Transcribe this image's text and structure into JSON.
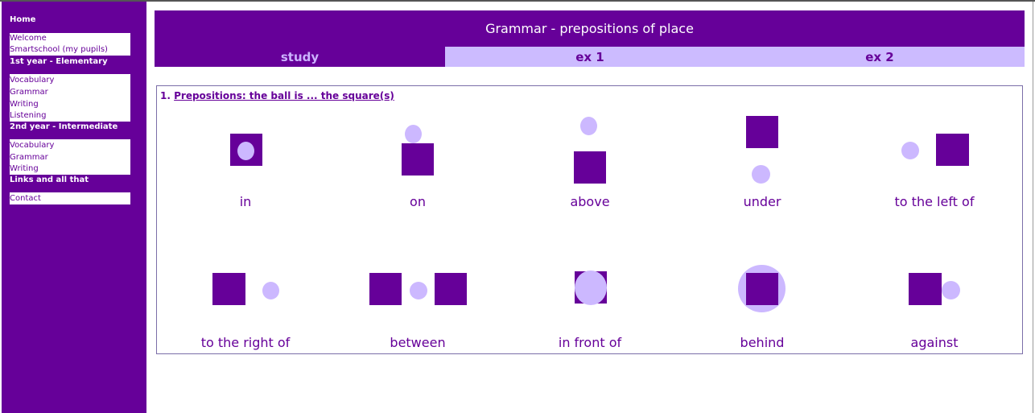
{
  "colors": {
    "brand": "#660099",
    "accent_light": "#ccbbff",
    "white": "#ffffff"
  },
  "sidebar": {
    "sections": [
      {
        "heading": "Home",
        "items": [
          "Welcome",
          "Smartschool (my pupils)"
        ]
      },
      {
        "heading": "1st year - Elementary",
        "items": [
          "Vocabulary",
          "Grammar",
          "Writing",
          "Listening"
        ]
      },
      {
        "heading": "2nd year - Intermediate",
        "items": [
          "Vocabulary",
          "Grammar",
          "Writing"
        ]
      },
      {
        "heading": "Links and all that",
        "items": [
          "Contact"
        ]
      }
    ]
  },
  "header": {
    "title": "Grammar - prepositions of place"
  },
  "tabs": [
    {
      "label": "study",
      "active": true
    },
    {
      "label": "ex 1",
      "active": false
    },
    {
      "label": "ex 2",
      "active": false
    }
  ],
  "content": {
    "section_number": "1.",
    "section_title": "Prepositions: the ball is ... the square(s)",
    "prepositions": [
      {
        "label": "in",
        "icon": "ball-in-square-icon"
      },
      {
        "label": "on",
        "icon": "ball-on-square-icon"
      },
      {
        "label": "above",
        "icon": "ball-above-square-icon"
      },
      {
        "label": "under",
        "icon": "ball-under-square-icon"
      },
      {
        "label": "to the left of",
        "icon": "ball-left-of-square-icon"
      },
      {
        "label": "to the right of",
        "icon": "ball-right-of-square-icon"
      },
      {
        "label": "between",
        "icon": "ball-between-squares-icon"
      },
      {
        "label": "in front of",
        "icon": "ball-in-front-of-square-icon"
      },
      {
        "label": "behind",
        "icon": "ball-behind-square-icon"
      },
      {
        "label": "against",
        "icon": "ball-against-square-icon"
      }
    ]
  }
}
